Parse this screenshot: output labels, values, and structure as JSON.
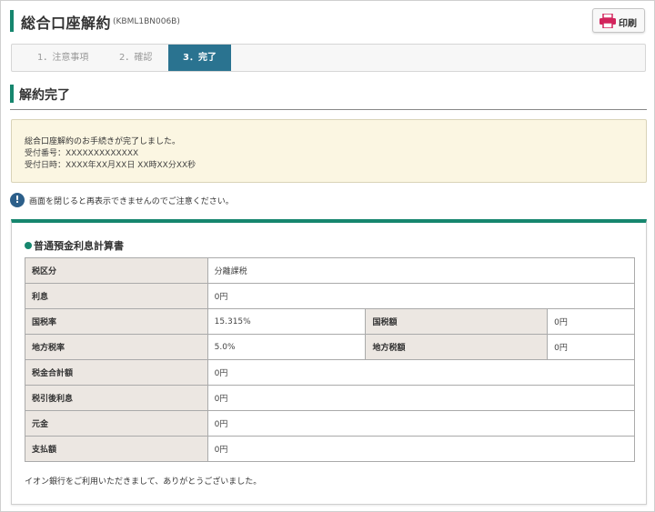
{
  "header": {
    "title": "総合口座解約",
    "code": "(KBML1BN006B)",
    "print_label": "印刷"
  },
  "steps": [
    {
      "label": "1．注意事項"
    },
    {
      "label": "2．確認"
    },
    {
      "label": "3．完了"
    }
  ],
  "section": {
    "title": "解約完了"
  },
  "notice": {
    "message": "総合口座解約のお手続きが完了しました。",
    "receipt_number": "受付番号：XXXXXXXXXXXXX",
    "receipt_datetime": "受付日時：XXXX年XX月XX日 XX時XX分XX秒"
  },
  "warning": {
    "text": "画面を閉じると再表示できませんのでご注意ください。"
  },
  "calc": {
    "title": "普通預金利息計算書",
    "rows": {
      "tax_category": {
        "label": "税区分",
        "value": "分離課税"
      },
      "interest": {
        "label": "利息",
        "value": "0円"
      },
      "national_tax_rate": {
        "label": "国税率",
        "value": "15.315%"
      },
      "national_tax_amount": {
        "label": "国税額",
        "value": "0円"
      },
      "local_tax_rate": {
        "label": "地方税率",
        "value": "5.0%"
      },
      "local_tax_amount": {
        "label": "地方税額",
        "value": "0円"
      },
      "total_tax": {
        "label": "税金合計額",
        "value": "0円"
      },
      "after_tax_interest": {
        "label": "税引後利息",
        "value": "0円"
      },
      "principal": {
        "label": "元金",
        "value": "0円"
      },
      "payment": {
        "label": "支払額",
        "value": "0円"
      }
    },
    "thanks": "イオン銀行をご利用いただきまして、ありがとうございました。"
  },
  "colors": {
    "accent_green": "#16866e",
    "active_step": "#2a7390",
    "notice_bg": "#fbf6e2",
    "table_header_bg": "#ece7e2",
    "print_icon": "#d2245c"
  }
}
